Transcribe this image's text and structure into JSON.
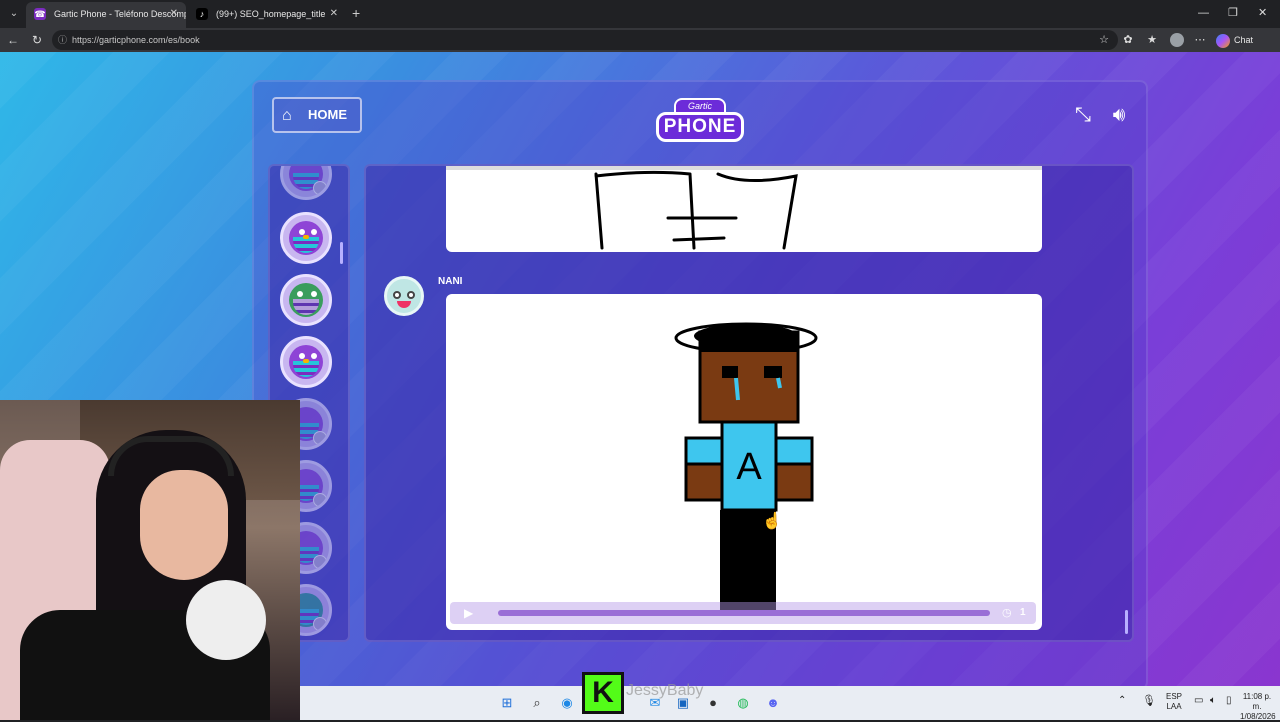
{
  "browser": {
    "tabs": [
      {
        "title": "Gartic Phone - Teléfono Descompu",
        "favicon": "☎",
        "active": true
      },
      {
        "title": "(99+) SEO_homepage_title",
        "favicon": "♪",
        "active": false
      }
    ],
    "url": "https://garticphone.com/es/book",
    "chat_label": "Chat"
  },
  "game": {
    "home_label": "HOME",
    "logo_top": "Gartic",
    "logo_main": "PHONE",
    "player_name": "NANI",
    "shirt_letter": "A",
    "replay_count": "1",
    "colors": {
      "accent": "#6c2bd9",
      "skin": "#7a3a12",
      "shirt": "#3ec6ee"
    }
  },
  "overlay": {
    "kick_letter": "K",
    "watermark": "JessyBaby"
  },
  "taskbar": {
    "lang_top": "ESP",
    "lang_bottom": "LAA",
    "time": "11:08 p. m.",
    "date": "1/08/2026"
  }
}
